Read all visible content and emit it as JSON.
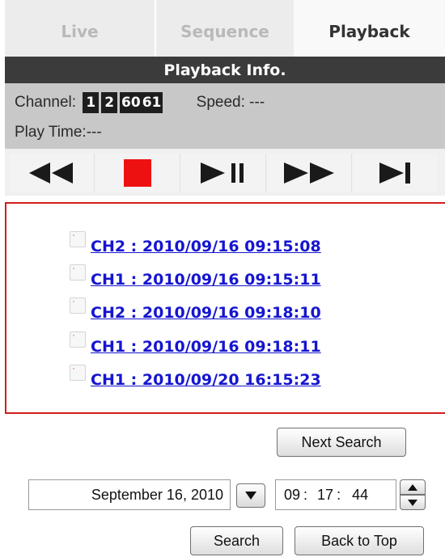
{
  "tabs": {
    "live": "Live",
    "sequence": "Sequence",
    "playback": "Playback"
  },
  "playback_info": {
    "title": "Playback Info.",
    "channel_label": "Channel:",
    "channels": [
      "1",
      "2",
      "60",
      "61"
    ],
    "speed_label": "Speed:",
    "speed_value": "---",
    "play_time_label": "Play Time:",
    "play_time_value": "---"
  },
  "controls": {
    "icons": [
      "rewind-icon",
      "stop-icon",
      "play-pause-icon",
      "fast-forward-icon",
      "next-frame-icon"
    ],
    "stop_color": "#ee1111",
    "icon_color": "#1a1a1a"
  },
  "results": [
    {
      "checked": false,
      "label": "CH2 : 2010/09/16 09:15:08"
    },
    {
      "checked": false,
      "label": "CH1 : 2010/09/16 09:15:11"
    },
    {
      "checked": false,
      "label": "CH2 : 2010/09/16 09:18:10"
    },
    {
      "checked": false,
      "label": "CH1 : 2010/09/16 09:18:11"
    },
    {
      "checked": false,
      "label": "CH1 : 2010/09/20 16:15:23"
    }
  ],
  "search": {
    "next_search_label": "Next Search",
    "date_value": "September 16, 2010",
    "time_hour": "09",
    "time_minute": "17",
    "time_second": "44",
    "time_separator": ":",
    "search_label": "Search",
    "back_to_top_label": "Back to Top"
  },
  "colors": {
    "result_border": "#d41c1c",
    "link": "#1515d0",
    "info_title_bg": "#3b3b3b"
  }
}
